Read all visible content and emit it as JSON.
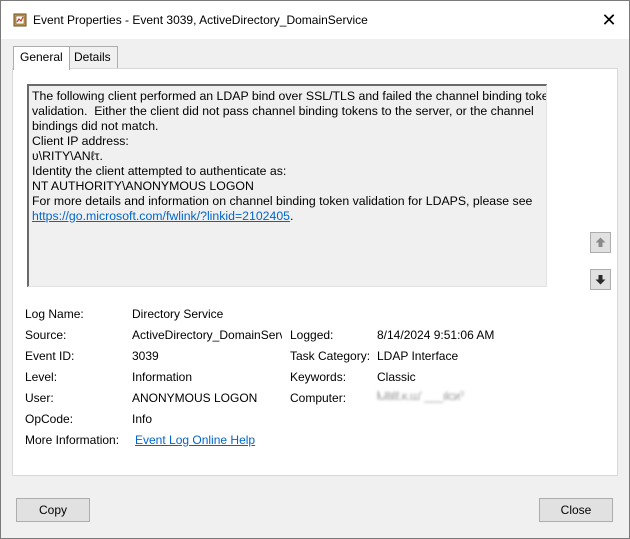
{
  "window": {
    "title": "Event Properties - Event 3039, ActiveDirectory_DomainService",
    "close_glyph": "✕"
  },
  "tabs": [
    {
      "label": "General",
      "active": true
    },
    {
      "label": "Details",
      "active": false
    }
  ],
  "description": {
    "lines": [
      "The following client performed an LDAP bind over SSL/TLS and failed the channel binding token",
      "validation.  Either the client did not pass channel binding tokens to the server, or the channel",
      "bindings did not match.",
      "Client IP address:",
      "ʋ\\RITY\\ANℓτ.",
      "Identity the client attempted to authenticate as:",
      "NT AUTHORITY\\ANONYMOUS LOGON",
      "For more details and information on channel binding token validation for LDAPS, please see"
    ],
    "link_text": "https://go.microsoft.com/fwlink/?linkid=2102405",
    "link_suffix": "."
  },
  "fields": {
    "log_name_label": "Log Name:",
    "log_name_value": "Directory Service",
    "source_label": "Source:",
    "source_value": "ActiveDirectory_DomainServ",
    "logged_label": "Logged:",
    "logged_value": "8/14/2024 9:51:06 AM",
    "event_id_label": "Event ID:",
    "event_id_value": "3039",
    "task_category_label": "Task Category:",
    "task_category_value": "LDAP Interface",
    "level_label": "Level:",
    "level_value": "Information",
    "keywords_label": "Keywords:",
    "keywords_value": "Classic",
    "user_label": "User:",
    "user_value": "ANONYMOUS LOGON",
    "computer_label": "Computer:",
    "computer_value": "ᗃlℓιℓℓ.κ.ɯ' ___ılcϰˀ",
    "opcode_label": "OpCode:",
    "opcode_value": "Info",
    "more_info_label": "More Information:",
    "more_info_link": "Event Log Online Help"
  },
  "buttons": {
    "copy": "Copy",
    "close": "Close"
  },
  "icons": {
    "app": "event-viewer-icon",
    "scroll_up": "arrow-up-icon",
    "scroll_down": "arrow-down-icon"
  }
}
